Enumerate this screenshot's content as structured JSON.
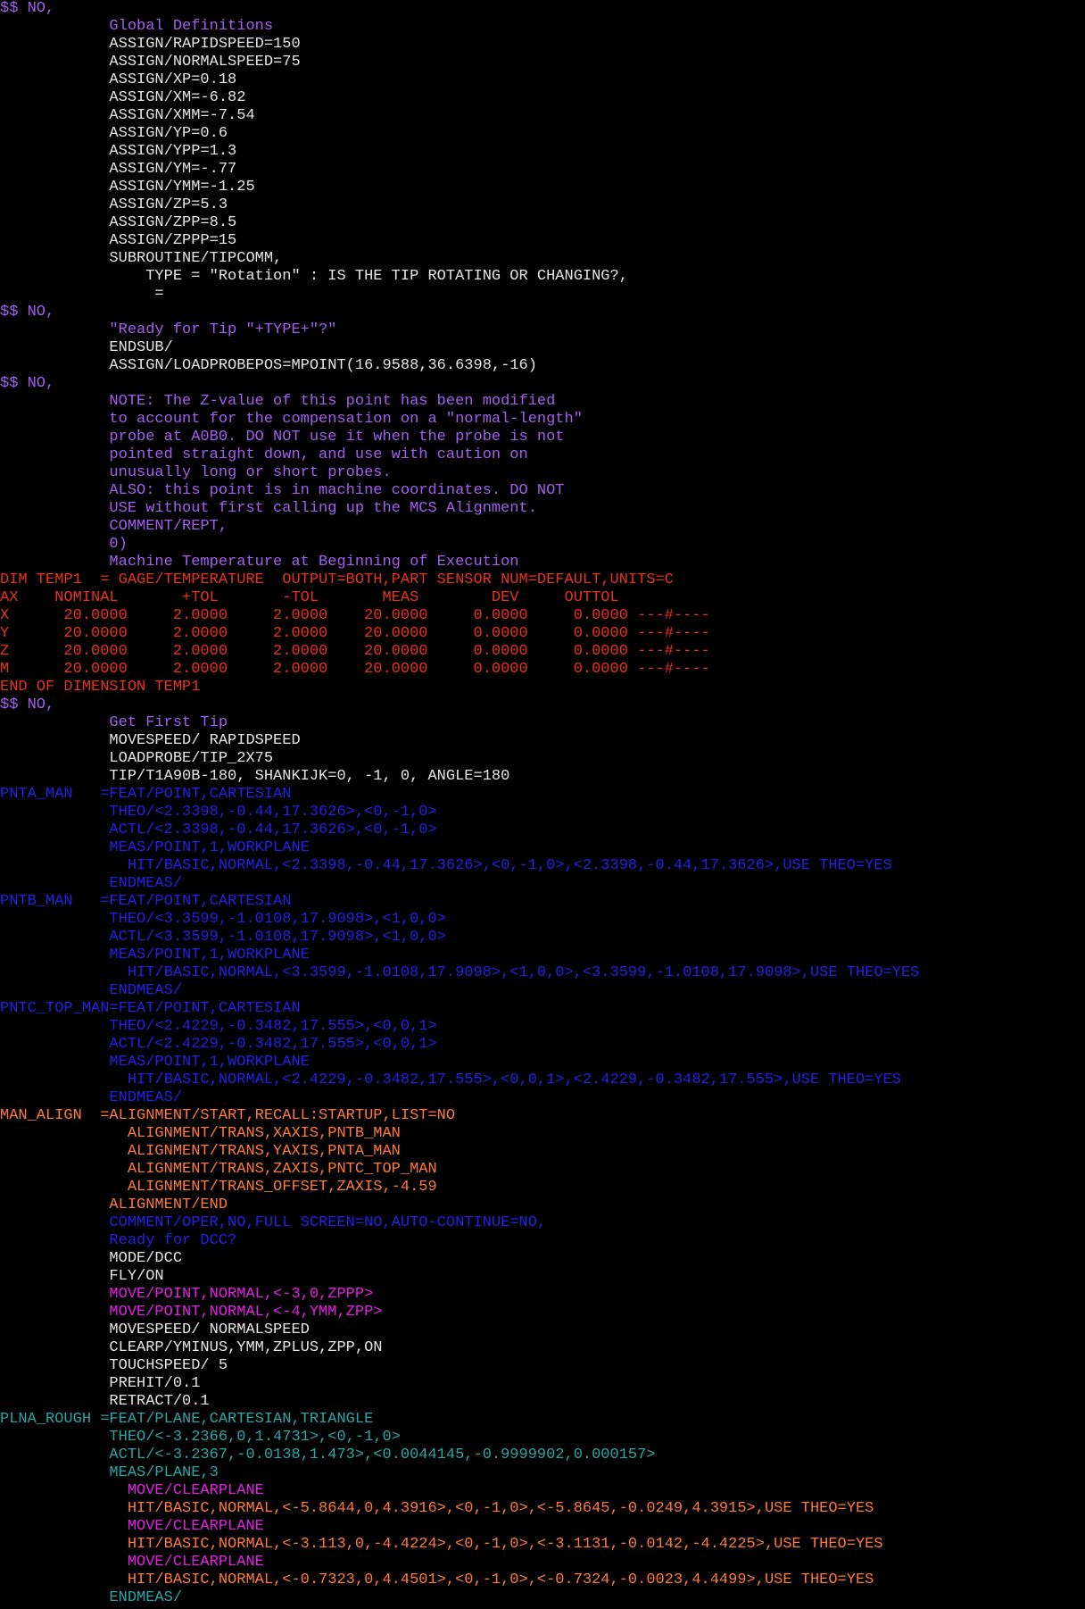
{
  "colors": {
    "background": "#000000",
    "white": "#e6e6e6",
    "purple": "#a45ef0",
    "red": "#e8321c",
    "orange": "#ff7a36",
    "blue": "#2222e6",
    "magenta": "#e61fe6",
    "teal": "#2aa6a6"
  },
  "lines": [
    {
      "text": "$$ NO,",
      "color": "purple"
    },
    {
      "text": "            Global Definitions",
      "color": "purple"
    },
    {
      "text": "            ASSIGN/RAPIDSPEED=150",
      "color": "white"
    },
    {
      "text": "            ASSIGN/NORMALSPEED=75",
      "color": "white"
    },
    {
      "text": "            ASSIGN/XP=0.18",
      "color": "white"
    },
    {
      "text": "            ASSIGN/XM=-6.82",
      "color": "white"
    },
    {
      "text": "            ASSIGN/XMM=-7.54",
      "color": "white"
    },
    {
      "text": "            ASSIGN/YP=0.6",
      "color": "white"
    },
    {
      "text": "            ASSIGN/YPP=1.3",
      "color": "white"
    },
    {
      "text": "            ASSIGN/YM=-.77",
      "color": "white"
    },
    {
      "text": "            ASSIGN/YMM=-1.25",
      "color": "white"
    },
    {
      "text": "            ASSIGN/ZP=5.3",
      "color": "white"
    },
    {
      "text": "            ASSIGN/ZPP=8.5",
      "color": "white"
    },
    {
      "text": "            ASSIGN/ZPPP=15",
      "color": "white"
    },
    {
      "text": "            SUBROUTINE/TIPCOMM,",
      "color": "white"
    },
    {
      "text": "                TYPE = \"Rotation\" : IS THE TIP ROTATING OR CHANGING?,",
      "color": "white"
    },
    {
      "text": "                 =",
      "color": "white"
    },
    {
      "text": "$$ NO,",
      "color": "purple"
    },
    {
      "text": "            \"Ready for Tip \"+TYPE+\"?\"",
      "color": "purple"
    },
    {
      "text": "            ENDSUB/",
      "color": "white"
    },
    {
      "text": "            ASSIGN/LOADPROBEPOS=MPOINT(16.9588,36.6398,-16)",
      "color": "white"
    },
    {
      "text": "$$ NO,",
      "color": "purple"
    },
    {
      "text": "            NOTE: The Z-value of this point has been modified",
      "color": "purple"
    },
    {
      "text": "            to account for the compensation on a \"normal-length\"",
      "color": "purple"
    },
    {
      "text": "            probe at A0B0. DO NOT use it when the probe is not",
      "color": "purple"
    },
    {
      "text": "            pointed straight down, and use with caution on",
      "color": "purple"
    },
    {
      "text": "            unusually long or short probes.",
      "color": "purple"
    },
    {
      "text": "            ALSO: this point is in machine coordinates. DO NOT",
      "color": "purple"
    },
    {
      "text": "            USE without first calling up the MCS Alignment.",
      "color": "purple"
    },
    {
      "text": "            COMMENT/REPT,",
      "color": "purple"
    },
    {
      "text": "            0)",
      "color": "purple"
    },
    {
      "text": "            Machine Temperature at Beginning of Execution",
      "color": "purple"
    },
    {
      "text": "DIM TEMP1  = GAGE/TEMPERATURE  OUTPUT=BOTH,PART SENSOR NUM=DEFAULT,UNITS=C",
      "color": "red"
    },
    {
      "text": "AX    NOMINAL       +TOL       -TOL       MEAS        DEV     OUTTOL",
      "color": "red"
    },
    {
      "text": "X      20.0000     2.0000     2.0000    20.0000     0.0000     0.0000 ---#----",
      "color": "red"
    },
    {
      "text": "Y      20.0000     2.0000     2.0000    20.0000     0.0000     0.0000 ---#----",
      "color": "red"
    },
    {
      "text": "Z      20.0000     2.0000     2.0000    20.0000     0.0000     0.0000 ---#----",
      "color": "red"
    },
    {
      "text": "M      20.0000     2.0000     2.0000    20.0000     0.0000     0.0000 ---#----",
      "color": "red"
    },
    {
      "text": "END OF DIMENSION TEMP1",
      "color": "red"
    },
    {
      "text": "$$ NO,",
      "color": "purple"
    },
    {
      "text": "            Get First Tip",
      "color": "purple"
    },
    {
      "text": "            MOVESPEED/ RAPIDSPEED",
      "color": "white"
    },
    {
      "text": "            LOADPROBE/TIP_2X75",
      "color": "white"
    },
    {
      "text": "            TIP/T1A90B-180, SHANKIJK=0, -1, 0, ANGLE=180",
      "color": "white"
    },
    {
      "text": "PNTA_MAN   =FEAT/POINT,CARTESIAN",
      "color": "blue"
    },
    {
      "text": "            THEO/<2.3398,-0.44,17.3626>,<0,-1,0>",
      "color": "blue"
    },
    {
      "text": "            ACTL/<2.3398,-0.44,17.3626>,<0,-1,0>",
      "color": "blue"
    },
    {
      "text": "            MEAS/POINT,1,WORKPLANE",
      "color": "blue"
    },
    {
      "text": "              HIT/BASIC,NORMAL,<2.3398,-0.44,17.3626>,<0,-1,0>,<2.3398,-0.44,17.3626>,USE THEO=YES",
      "color": "blue"
    },
    {
      "text": "            ENDMEAS/",
      "color": "blue"
    },
    {
      "text": "PNTB_MAN   =FEAT/POINT,CARTESIAN",
      "color": "blue"
    },
    {
      "text": "            THEO/<3.3599,-1.0108,17.9098>,<1,0,0>",
      "color": "blue"
    },
    {
      "text": "            ACTL/<3.3599,-1.0108,17.9098>,<1,0,0>",
      "color": "blue"
    },
    {
      "text": "            MEAS/POINT,1,WORKPLANE",
      "color": "blue"
    },
    {
      "text": "              HIT/BASIC,NORMAL,<3.3599,-1.0108,17.9098>,<1,0,0>,<3.3599,-1.0108,17.9098>,USE THEO=YES",
      "color": "blue"
    },
    {
      "text": "            ENDMEAS/",
      "color": "blue"
    },
    {
      "text": "PNTC_TOP_MAN=FEAT/POINT,CARTESIAN",
      "color": "blue"
    },
    {
      "text": "            THEO/<2.4229,-0.3482,17.555>,<0,0,1>",
      "color": "blue"
    },
    {
      "text": "            ACTL/<2.4229,-0.3482,17.555>,<0,0,1>",
      "color": "blue"
    },
    {
      "text": "            MEAS/POINT,1,WORKPLANE",
      "color": "blue"
    },
    {
      "text": "              HIT/BASIC,NORMAL,<2.4229,-0.3482,17.555>,<0,0,1>,<2.4229,-0.3482,17.555>,USE THEO=YES",
      "color": "blue"
    },
    {
      "text": "            ENDMEAS/",
      "color": "blue"
    },
    {
      "text": "MAN_ALIGN  =ALIGNMENT/START,RECALL:STARTUP,LIST=NO",
      "color": "orange"
    },
    {
      "text": "              ALIGNMENT/TRANS,XAXIS,PNTB_MAN",
      "color": "orange"
    },
    {
      "text": "              ALIGNMENT/TRANS,YAXIS,PNTA_MAN",
      "color": "orange"
    },
    {
      "text": "              ALIGNMENT/TRANS,ZAXIS,PNTC_TOP_MAN",
      "color": "orange"
    },
    {
      "text": "              ALIGNMENT/TRANS_OFFSET,ZAXIS,-4.59",
      "color": "orange"
    },
    {
      "text": "            ALIGNMENT/END",
      "color": "orange"
    },
    {
      "text": "            COMMENT/OPER,NO,FULL SCREEN=NO,AUTO-CONTINUE=NO,",
      "color": "blue"
    },
    {
      "text": "            Ready for DCC?",
      "color": "blue"
    },
    {
      "text": "            MODE/DCC",
      "color": "white"
    },
    {
      "text": "            FLY/ON",
      "color": "white"
    },
    {
      "text": "            MOVE/POINT,NORMAL,<-3,0,ZPPP>",
      "color": "magenta"
    },
    {
      "text": "            MOVE/POINT,NORMAL,<-4,YMM,ZPP>",
      "color": "magenta"
    },
    {
      "text": "            MOVESPEED/ NORMALSPEED",
      "color": "white"
    },
    {
      "text": "            CLEARP/YMINUS,YMM,ZPLUS,ZPP,ON",
      "color": "white"
    },
    {
      "text": "            TOUCHSPEED/ 5",
      "color": "white"
    },
    {
      "text": "            PREHIT/0.1",
      "color": "white"
    },
    {
      "text": "            RETRACT/0.1",
      "color": "white"
    },
    {
      "text": "PLNA_ROUGH =FEAT/PLANE,CARTESIAN,TRIANGLE",
      "color": "teal"
    },
    {
      "text": "            THEO/<-3.2366,0,1.4731>,<0,-1,0>",
      "color": "teal"
    },
    {
      "text": "            ACTL/<-3.2367,-0.0138,1.473>,<0.0044145,-0.9999902,0.000157>",
      "color": "teal"
    },
    {
      "text": "            MEAS/PLANE,3",
      "color": "teal"
    },
    {
      "text": "              MOVE/CLEARPLANE",
      "color": "magenta"
    },
    {
      "text": "              HIT/BASIC,NORMAL,<-5.8644,0,4.3916>,<0,-1,0>,<-5.8645,-0.0249,4.3915>,USE THEO=YES",
      "color": "orange"
    },
    {
      "text": "              MOVE/CLEARPLANE",
      "color": "magenta"
    },
    {
      "text": "              HIT/BASIC,NORMAL,<-3.113,0,-4.4224>,<0,-1,0>,<-3.1131,-0.0142,-4.4225>,USE THEO=YES",
      "color": "orange"
    },
    {
      "text": "              MOVE/CLEARPLANE",
      "color": "magenta"
    },
    {
      "text": "              HIT/BASIC,NORMAL,<-0.7323,0,4.4501>,<0,-1,0>,<-0.7324,-0.0023,4.4499>,USE THEO=YES",
      "color": "orange"
    },
    {
      "text": "            ENDMEAS/",
      "color": "teal"
    }
  ]
}
